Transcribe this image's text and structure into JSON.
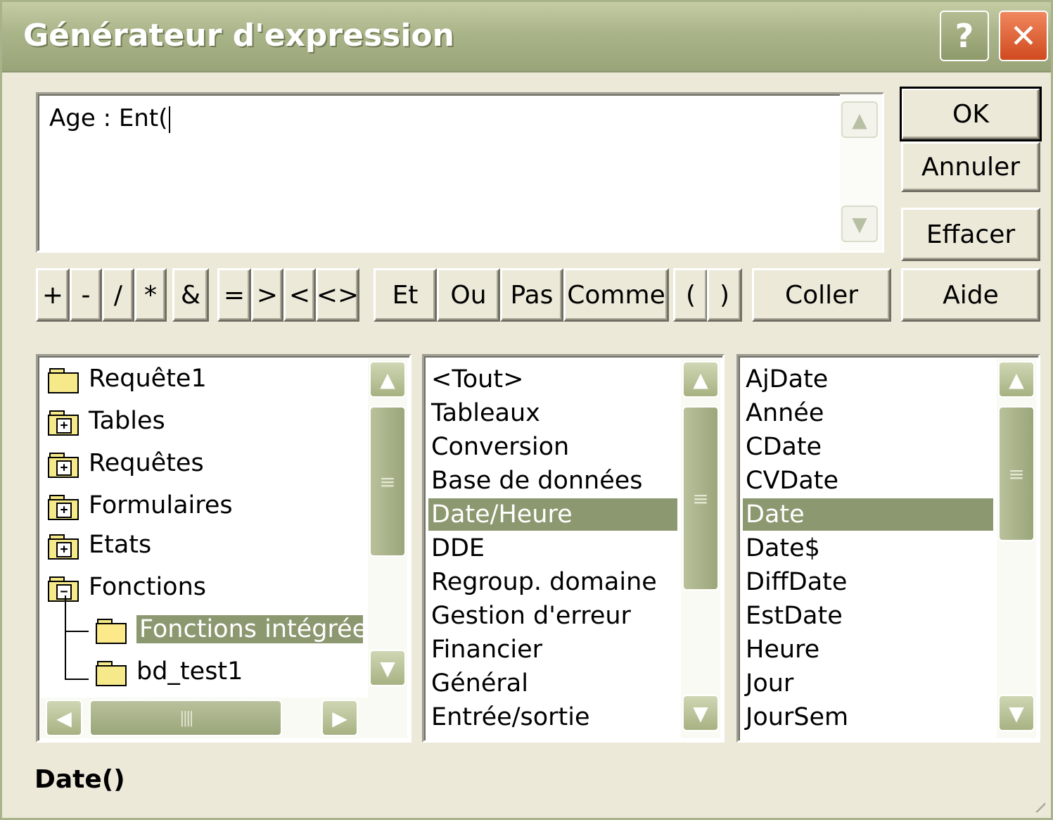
{
  "window": {
    "title": "Générateur d'expression",
    "help_label": "?",
    "close_label": "✕"
  },
  "expression": {
    "value": "Age : Ent("
  },
  "buttons": {
    "ok": "OK",
    "cancel": "Annuler",
    "clear": "Effacer",
    "paste": "Coller",
    "help": "Aide"
  },
  "operators": [
    "+",
    "-",
    "/",
    "*",
    "&",
    "=",
    ">",
    "<",
    "<>",
    "Et",
    "Ou",
    "Pas",
    "Comme",
    "(",
    ")"
  ],
  "tree": {
    "items": [
      {
        "label": "Requête1",
        "icon": "folder-icon"
      },
      {
        "label": "Tables",
        "icon": "folder-plus-icon"
      },
      {
        "label": "Requêtes",
        "icon": "folder-plus-icon"
      },
      {
        "label": "Formulaires",
        "icon": "folder-plus-icon"
      },
      {
        "label": "Etats",
        "icon": "folder-plus-icon"
      },
      {
        "label": "Fonctions",
        "icon": "folder-minus-icon"
      },
      {
        "label": "Fonctions intégrées",
        "icon": "folder-open-icon",
        "selected": true
      },
      {
        "label": "bd_test1",
        "icon": "folder-icon"
      }
    ]
  },
  "categories": {
    "items": [
      "<Tout>",
      "Tableaux",
      "Conversion",
      "Base de données",
      "Date/Heure",
      "DDE",
      "Regroup. domaine",
      "Gestion d'erreur",
      "Financier",
      "Général",
      "Entrée/sortie"
    ],
    "selected": "Date/Heure"
  },
  "functions": {
    "items": [
      "AjDate",
      "Année",
      "CDate",
      "CVDate",
      "Date",
      "Date$",
      "DiffDate",
      "EstDate",
      "Heure",
      "Jour",
      "JourSem"
    ],
    "selected": "Date"
  },
  "status": {
    "text": "Date()"
  },
  "colors": {
    "titlebar": "#aab489",
    "selection": "#8c9870",
    "dialog_bg": "#ece9d8",
    "close_button": "#d04a1e"
  }
}
